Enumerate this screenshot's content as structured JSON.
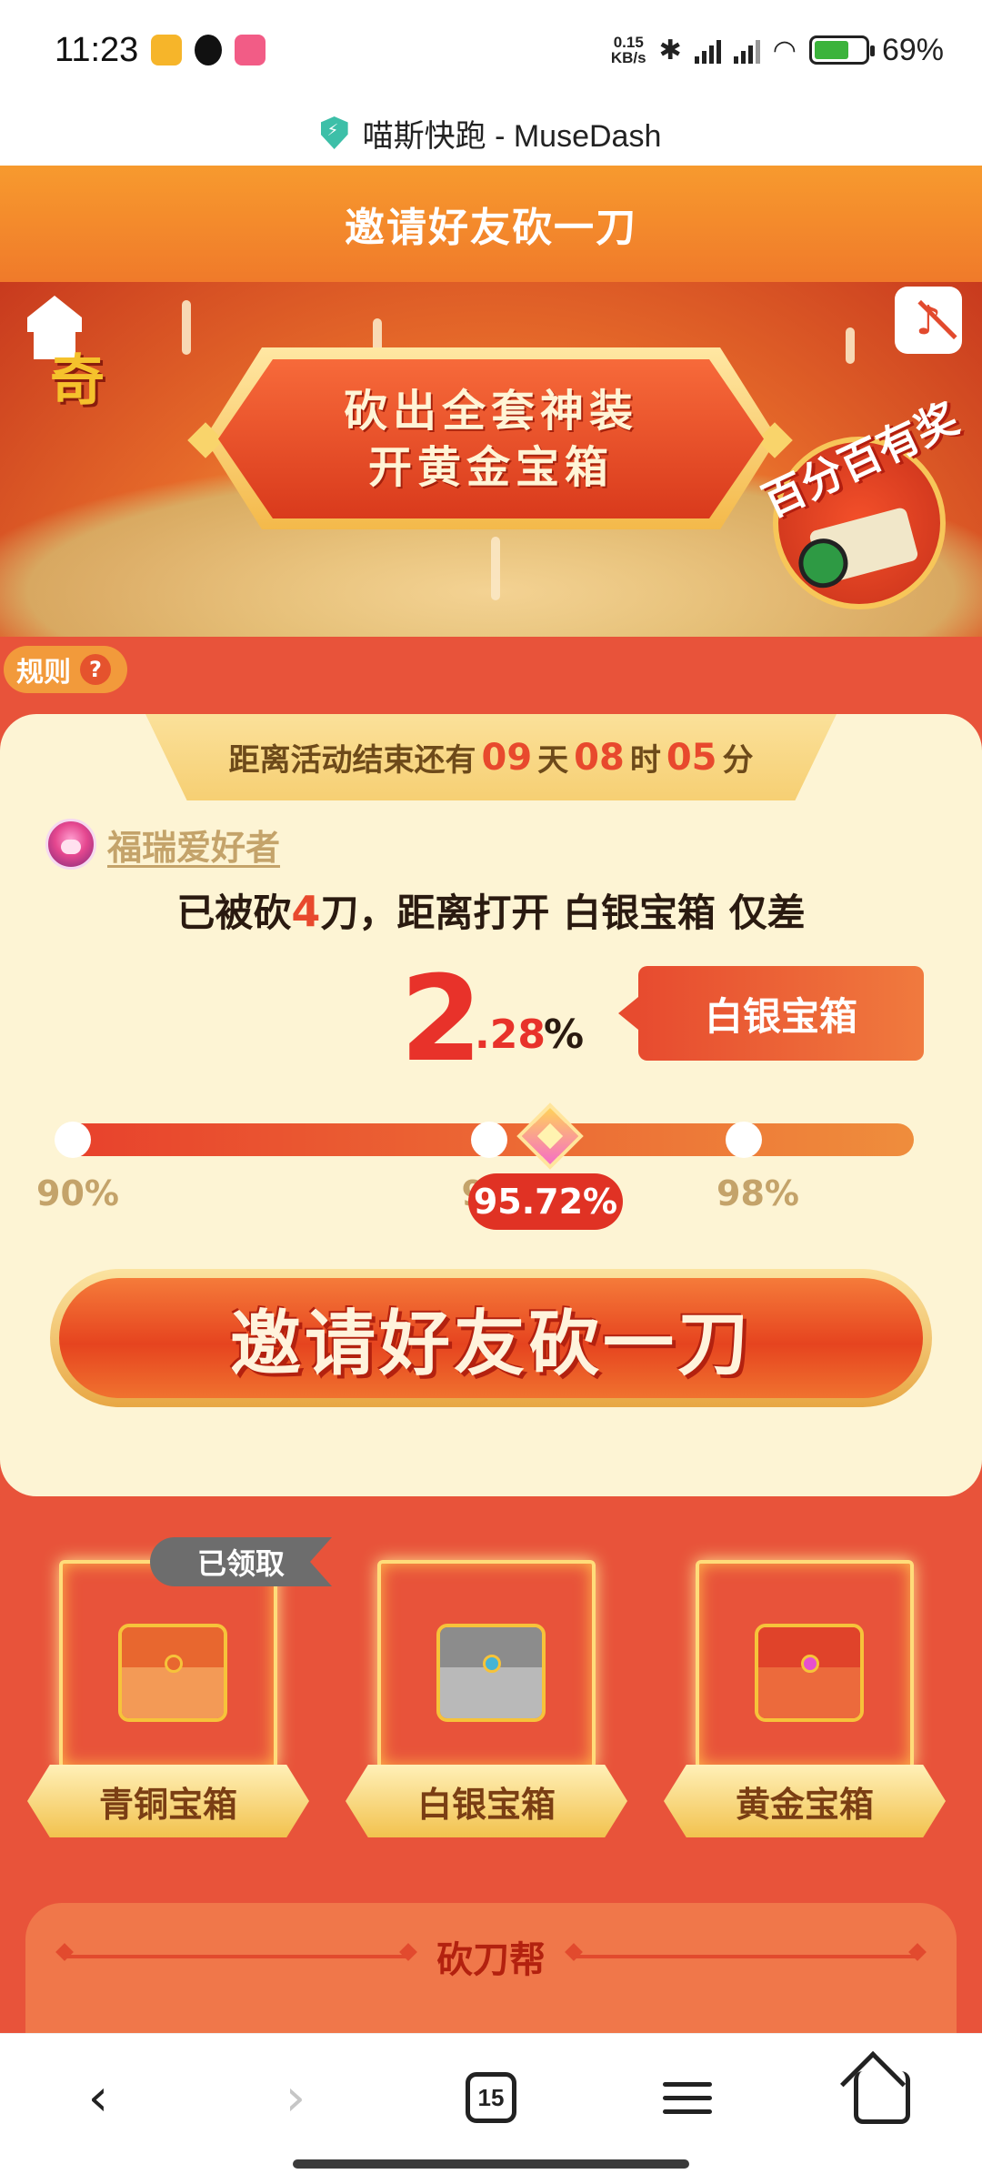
{
  "status_bar": {
    "time": "11:23",
    "network_speed_value": "0.15",
    "network_speed_unit": "KB/s",
    "battery_percent": "69%",
    "battery_level": 0.69
  },
  "browser": {
    "site_title": "喵斯快跑 - MuseDash",
    "tab_count": "15"
  },
  "header": {
    "title": "邀请好友砍一刀"
  },
  "banner": {
    "corner_char": "奇",
    "slogan_line1": "砍出全套神装",
    "slogan_line2": "开黄金宝箱",
    "prize_badge": "百分百有奖"
  },
  "rules": {
    "label": "规则",
    "icon_char": "?"
  },
  "countdown": {
    "prefix": "距离活动结束还有",
    "days": "09",
    "days_unit": "天",
    "hours": "08",
    "hours_unit": "时",
    "minutes": "05",
    "minutes_unit": "分"
  },
  "user": {
    "name": "福瑞爱好者"
  },
  "status": {
    "part1": "已被砍",
    "cut_count": "4",
    "part2": "刀，距离打开 白银宝箱 仅差"
  },
  "remaining": {
    "integer": "2",
    "decimal": ".28",
    "unit": "%"
  },
  "target_chest": "白银宝箱",
  "progress": {
    "current_label": "95.72%",
    "current_value": 95.72,
    "min_value": 90,
    "max_value": 100,
    "milestones": [
      {
        "label": "90%",
        "value": 90
      },
      {
        "label": "9",
        "value": 95
      },
      {
        "label": "98%",
        "value": 98
      }
    ]
  },
  "invite_button": "邀请好友砍一刀",
  "chests": [
    {
      "label": "青铜宝箱",
      "claimed": "已领取",
      "lid_color": "#e8672f",
      "base_color": "#f39a56",
      "gem_color": "#e8672f"
    },
    {
      "label": "白银宝箱",
      "claimed": "",
      "lid_color": "#8c8c8c",
      "base_color": "#b9b9b9",
      "gem_color": "#45b4d6"
    },
    {
      "label": "黄金宝箱",
      "claimed": "",
      "lid_color": "#e0432a",
      "base_color": "#ec6a3c",
      "gem_color": "#e64fd0"
    }
  ],
  "helpers": {
    "title": "砍刀帮"
  },
  "colors": {
    "accent_red": "#e8492d",
    "page_bg": "#e8533a",
    "card_bg": "#fdf4d4",
    "gold": "#f6c33a"
  }
}
